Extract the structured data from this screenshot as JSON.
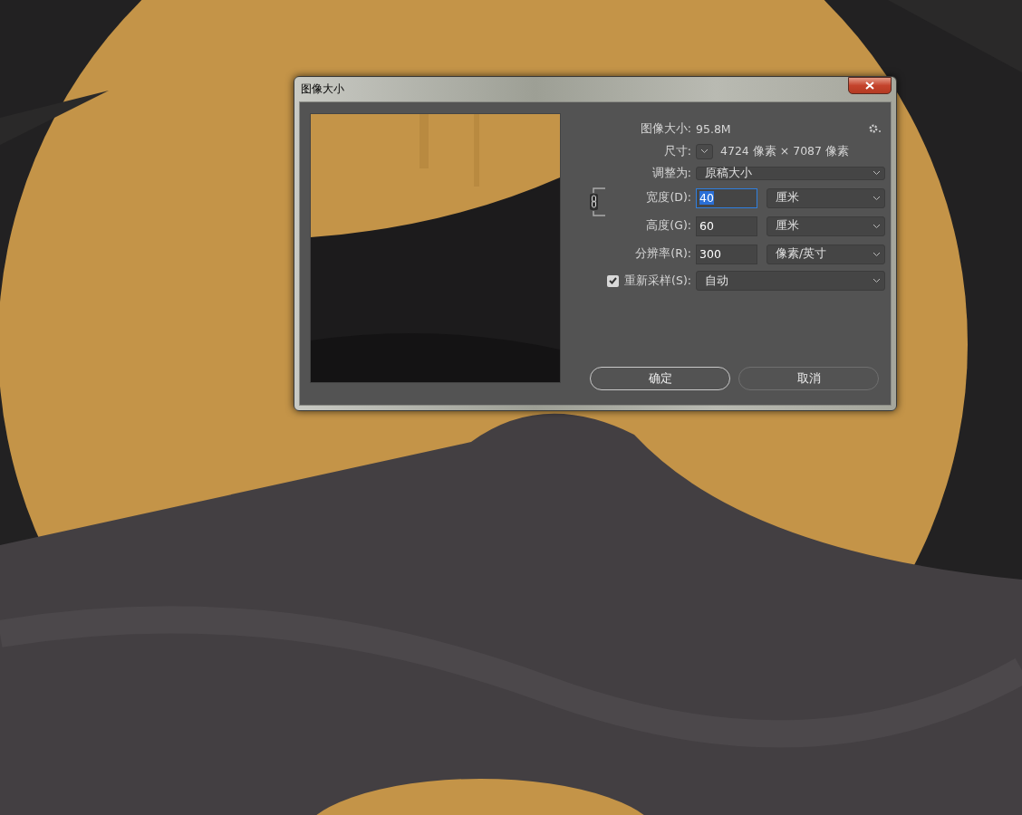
{
  "window": {
    "title": "图像大小"
  },
  "image_size": {
    "label": "图像大小:",
    "value": "95.8M"
  },
  "dimensions": {
    "label": "尺寸:",
    "value": "4724 像素 × 7087 像素"
  },
  "fit_to": {
    "label": "调整为:",
    "value": "原稿大小"
  },
  "constrain": {
    "on": true
  },
  "fields": [
    {
      "label": "宽度(D):",
      "value": "40",
      "focused": true,
      "unit": "厘米"
    },
    {
      "label": "高度(G):",
      "value": "60",
      "focused": false,
      "unit": "厘米"
    },
    {
      "label": "分辨率(R):",
      "value": "300",
      "focused": false,
      "unit": "像素/英寸"
    }
  ],
  "resample": {
    "checked": true,
    "label": "重新采样(S):",
    "value": "自动"
  },
  "buttons": [
    {
      "label": "确定",
      "default": true
    },
    {
      "label": "取消",
      "default": false
    }
  ]
}
